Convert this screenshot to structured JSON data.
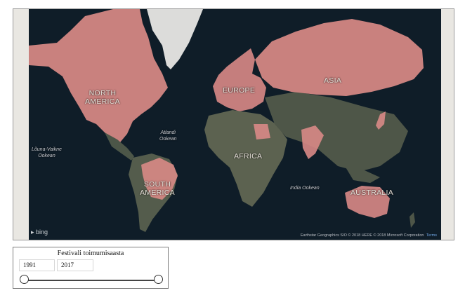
{
  "map": {
    "labels": {
      "north_america": "NORTH\nAMERICA",
      "europe": "EUROPE",
      "asia": "ASIA",
      "africa": "AFRICA",
      "south_america": "SOUTH\nAMERICA",
      "australia": "AUSTRALIA",
      "pacific": "Lõuna-Vaikne\nOokean",
      "atlantic": "Atlandi\nOokean",
      "indian": "India Ookean"
    },
    "provider_logo": "bing",
    "attribution": "Earthstar Geographics SIO © 2018 HERE © 2018 Microsoft Corporation",
    "terms_link": "Terms",
    "colors": {
      "ocean": "#0f1d28",
      "land": "#4a5246",
      "highlight": "#e78f8f",
      "border_lines": "#e8e4da"
    }
  },
  "filter": {
    "title": "Festivali toimumisaasta",
    "year_start": "1991",
    "year_end": "2017"
  }
}
